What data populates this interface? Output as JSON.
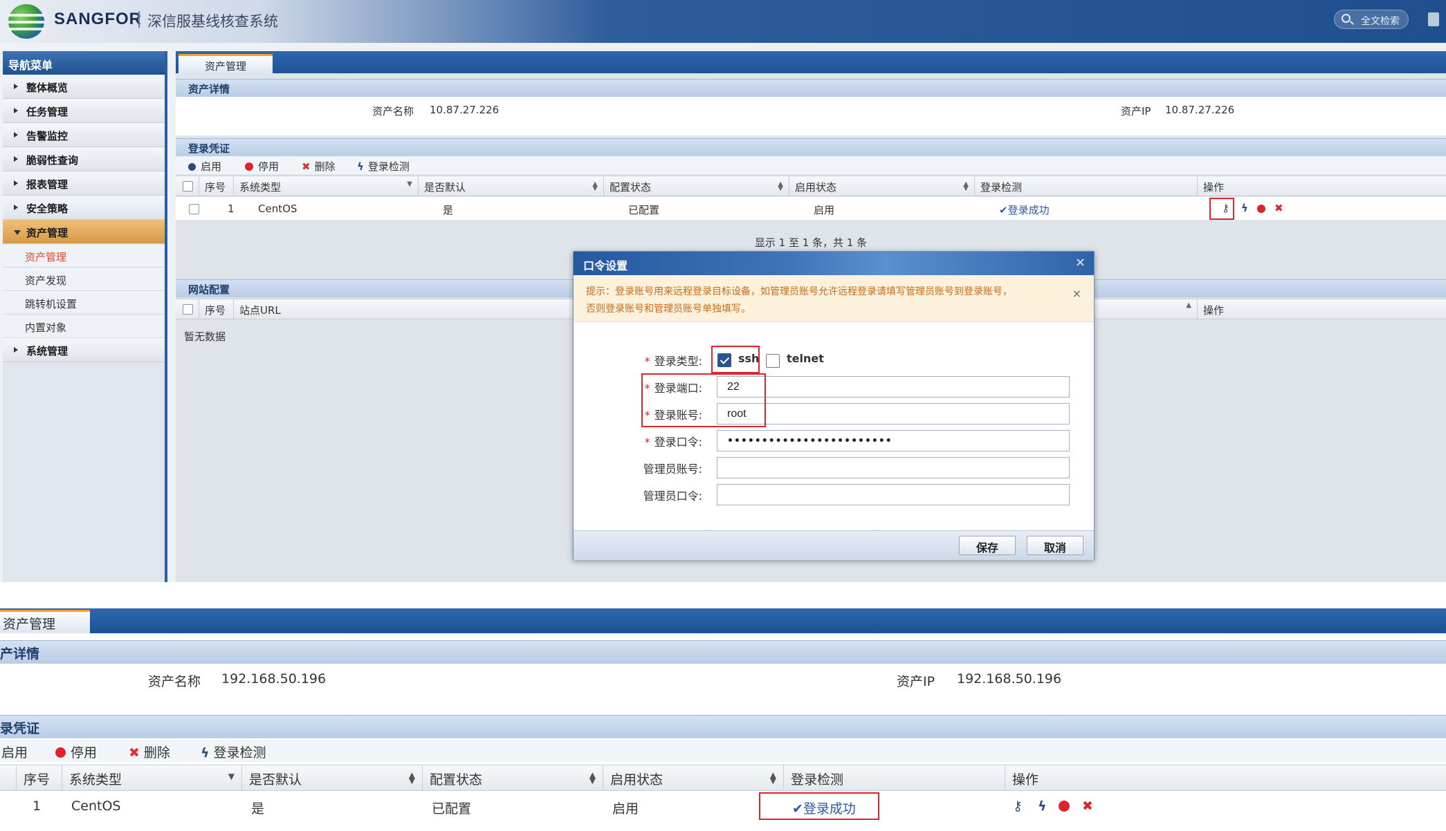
{
  "header": {
    "brand": "SANGFOR",
    "system_title": "深信服基线核查系统",
    "search_label": "全文检索"
  },
  "sidebar": {
    "title": "导航菜单",
    "items": [
      {
        "label": "整体概览"
      },
      {
        "label": "任务管理"
      },
      {
        "label": "告警监控"
      },
      {
        "label": "脆弱性查询"
      },
      {
        "label": "报表管理"
      },
      {
        "label": "安全策略"
      },
      {
        "label": "资产管理"
      },
      {
        "label": "系统管理"
      }
    ],
    "subitems": [
      {
        "label": "资产管理"
      },
      {
        "label": "资产发现"
      },
      {
        "label": "跳转机设置"
      },
      {
        "label": "内置对象"
      }
    ]
  },
  "top": {
    "tab": "资产管理",
    "detail_section": "资产详情",
    "asset_name_label": "资产名称",
    "asset_name": "10.87.27.226",
    "asset_ip_label": "资产IP",
    "asset_ip": "10.87.27.226",
    "cred_section": "登录凭证",
    "toolbar": {
      "enable": "启用",
      "disable": "停用",
      "delete": "删除",
      "check": "登录检测"
    },
    "columns": [
      "序号",
      "系统类型",
      "是否默认",
      "配置状态",
      "启用状态",
      "登录检测",
      "操作"
    ],
    "row": {
      "index": "1",
      "os": "CentOS",
      "default": "是",
      "config": "已配置",
      "status": "启用",
      "check": "登录成功"
    },
    "pager": "显示 1 至 1 条，共 1 条",
    "site_section": "网站配置",
    "site_columns": [
      "序号",
      "站点URL",
      "操作"
    ],
    "no_data": "暂无数据"
  },
  "modal": {
    "title": "口令设置",
    "tip_line1": "提示：登录账号用来远程登录目标设备，如管理员账号允许远程登录请填写管理员账号到登录账号，",
    "tip_line2": "否则登录账号和管理员账号单独填写。",
    "login_type_label": "登录类型:",
    "ssh_label": "ssh",
    "telnet_label": "telnet",
    "ssh_checked": true,
    "telnet_checked": false,
    "port_label": "登录端口:",
    "port_value": "22",
    "account_label": "登录账号:",
    "account_value": "root",
    "password_label": "登录口令:",
    "password_value": "••••••••••••••••••••••••",
    "admin_account_label": "管理员账号:",
    "admin_account_value": "",
    "admin_password_label": "管理员口令:",
    "admin_password_value": "",
    "save_label": "保存",
    "cancel_label": "取消"
  },
  "bottom": {
    "tab": "资产管理",
    "detail_section": "产详情",
    "asset_name_label": "资产名称",
    "asset_name": "192.168.50.196",
    "asset_ip_label": "资产IP",
    "asset_ip": "192.168.50.196",
    "cred_section": "录凭证",
    "toolbar": {
      "enable": "启用",
      "disable": "停用",
      "delete": "删除",
      "check": "登录检测"
    },
    "columns": [
      "序号",
      "系统类型",
      "是否默认",
      "配置状态",
      "启用状态",
      "登录检测",
      "操作"
    ],
    "row": {
      "index": "1",
      "os": "CentOS",
      "default": "是",
      "config": "已配置",
      "status": "启用",
      "check": "登录成功"
    }
  },
  "colors": {
    "accent": "#1e5295",
    "danger": "#e0232b",
    "tab_highlight": "#f0a22c",
    "tip_text": "#c96a1c"
  }
}
